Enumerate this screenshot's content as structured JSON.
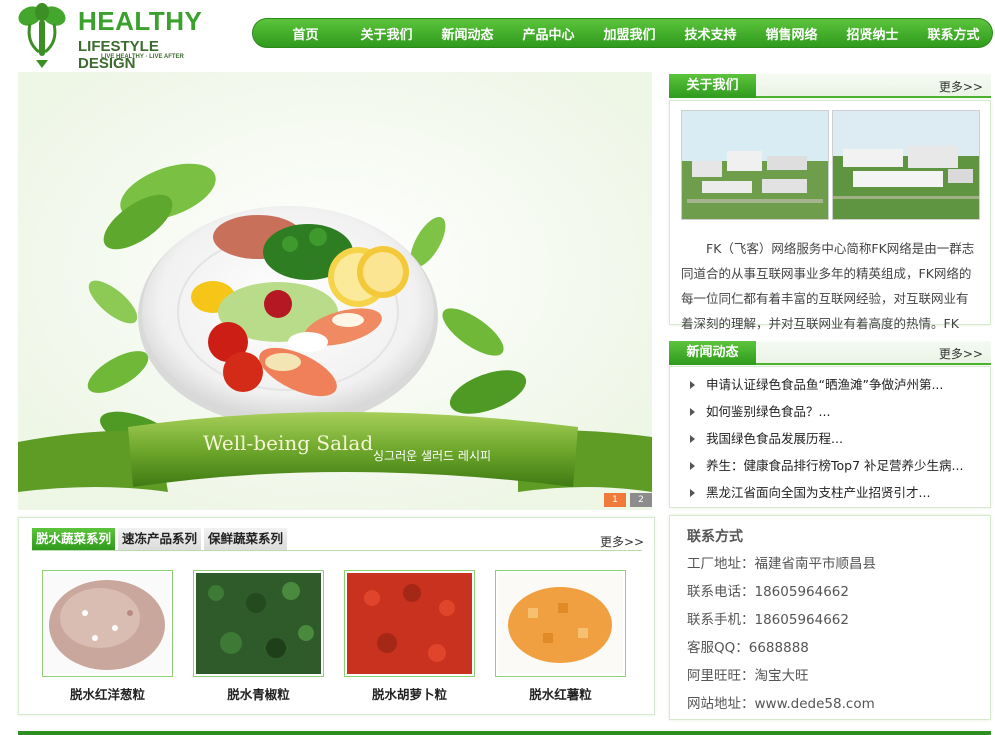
{
  "logo": {
    "brand": "HEALTHY",
    "subtitle": "LIFESTYLE DESIGN",
    "tagline": "LIVE HEALTHY · LIVE AFTER"
  },
  "nav": [
    "首页",
    "关于我们",
    "新闻动态",
    "产品中心",
    "加盟我们",
    "技术支持",
    "销售网络",
    "招贤纳士",
    "联系方式"
  ],
  "banner": {
    "ribbon_text": "Well-being Salad",
    "ribbon_korean": "싱그러운 샐러드 레시피",
    "pages": [
      "1",
      "2"
    ]
  },
  "about": {
    "title": "关于我们",
    "more": "更多>>",
    "text": "FK（飞客）网络服务中心简称FK网络是由一群志同道合的从事互联网事业多年的精英组成，FK网络的每一位同仁都有着丰富的互联网经验，对互联网业有着深刻的理解，并对互联网业有着高度的热情。FK网..."
  },
  "news": {
    "title": "新闻动态",
    "more": "更多>>",
    "items": [
      "申请认证绿色食品鱼“晒渔滩”争做泸州第...",
      "如何鉴别绿色食品？...",
      "我国绿色食品发展历程...",
      "养生：健康食品排行榜Top7 补足营养少生病...",
      "黑龙江省面向全国为支柱产业招贤引才..."
    ]
  },
  "contact": {
    "title": "联系方式",
    "lines": [
      "工厂地址：福建省南平市顺昌县",
      "联系电话：18605964662",
      "联系手机：18605964662",
      "客服QQ：6688888",
      "阿里旺旺：淘宝大旺",
      "网站地址：www.dede58.com"
    ]
  },
  "products": {
    "tabs": [
      "脱水蔬菜系列",
      "速冻产品系列",
      "保鲜蔬菜系列"
    ],
    "more": "更多>>",
    "items": [
      {
        "name": "脱水红洋葱粒",
        "color": "#c9a79c"
      },
      {
        "name": "脱水青椒粒",
        "color": "#2f5a2a"
      },
      {
        "name": "脱水胡萝卜粒",
        "color": "#c8321e"
      },
      {
        "name": "脱水红薯粒",
        "color": "#f0a040"
      }
    ]
  },
  "colors": {
    "accent": "#3aa12c",
    "dark_green": "#2c8f1f"
  }
}
